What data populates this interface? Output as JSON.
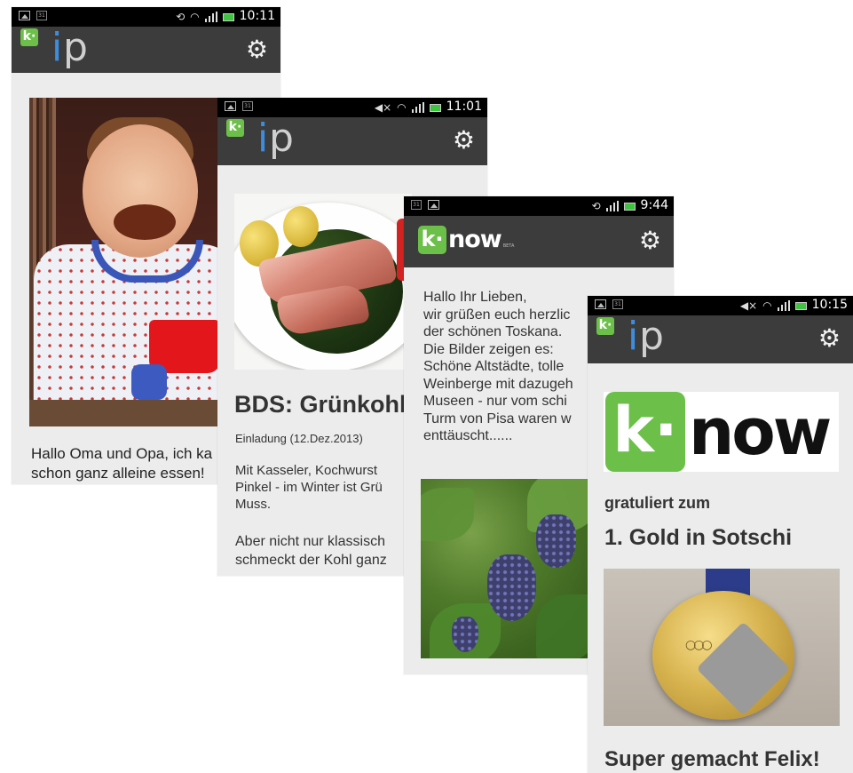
{
  "phones": [
    {
      "status": {
        "time": "10:11"
      },
      "appbar": {
        "logo_badge": "k·",
        "logo_i": "i",
        "logo_p": "p",
        "settings_icon": "gear-icon"
      },
      "photo": {
        "subject": "baby-photo"
      },
      "text": "Hallo Oma und Opa, ich ka\nschon ganz alleine essen!"
    },
    {
      "status": {
        "time": "11:01"
      },
      "appbar": {
        "logo_badge": "k·",
        "logo_i": "i",
        "logo_p": "p",
        "settings_icon": "gear-icon"
      },
      "photo": {
        "subject": "food-photo"
      },
      "title": "BDS: Grünkohl",
      "subtitle": "Einladung (12.Dez.2013)",
      "paragraph1": "Mit Kasseler, Kochwurst\nPinkel - im Winter ist Grü\nMuss.",
      "paragraph2": "Aber nicht nur klassisch\nschmeckt der Kohl ganz"
    },
    {
      "status": {
        "time": "9:44"
      },
      "appbar": {
        "logo_badge": "k·",
        "logo_word": "now",
        "logo_tm": "BETA",
        "settings_icon": "gear-icon"
      },
      "text": "Hallo Ihr Lieben,\nwir grüßen euch herzlic\nder schönen Toskana.\nDie Bilder zeigen es:\nSchöne Altstädte, tolle\nWeinberge mit dazugeh\nMuseen - nur vom schi\nTurm von Pisa waren w\nenttäuscht......",
      "photo": {
        "subject": "grapes-photo"
      }
    },
    {
      "status": {
        "time": "10:15"
      },
      "appbar": {
        "logo_badge": "k·",
        "logo_i": "i",
        "logo_p": "p",
        "settings_icon": "gear-icon"
      },
      "banner": {
        "k": "k·",
        "word": "now"
      },
      "kicker": "gratuliert zum",
      "headline": "1. Gold in Sotschi",
      "photo": {
        "subject": "medal-photo"
      },
      "footer": "Super gemacht Felix!"
    }
  ],
  "colors": {
    "statusbar": "#000000",
    "appbar": "#3c3c3c",
    "accent_green": "#6cc04a",
    "logo_i_blue": "#3c8de0",
    "content_bg": "#ececec"
  }
}
